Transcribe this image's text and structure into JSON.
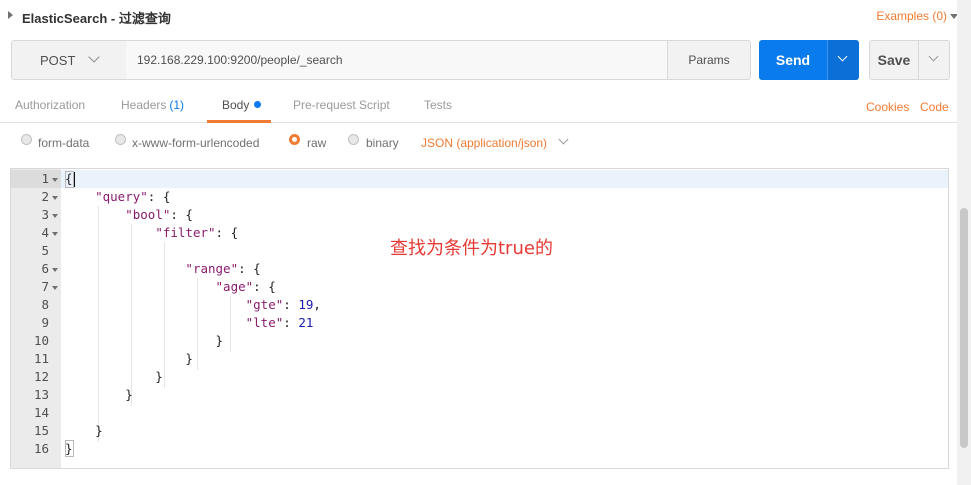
{
  "request": {
    "title": "ElasticSearch - 过滤查询",
    "examples_label": "Examples (0)"
  },
  "toolbar": {
    "method": "POST",
    "url": "192.168.229.100:9200/people/_search",
    "params_label": "Params",
    "send_label": "Send",
    "save_label": "Save"
  },
  "tabs": [
    {
      "label": "Authorization"
    },
    {
      "label": "Headers",
      "count": "(1)"
    },
    {
      "label": "Body",
      "active": true
    },
    {
      "label": "Pre-request Script"
    },
    {
      "label": "Tests"
    }
  ],
  "links": {
    "cookies": "Cookies",
    "code": "Code"
  },
  "body_options": {
    "items": [
      "form-data",
      "x-www-form-urlencoded",
      "raw",
      "binary"
    ],
    "selected": "raw",
    "content_type": "JSON (application/json)"
  },
  "editor": {
    "line_numbers": [
      "1",
      "2",
      "3",
      "4",
      "5",
      "6",
      "7",
      "8",
      "9",
      "10",
      "11",
      "12",
      "13",
      "14",
      "15",
      "16"
    ],
    "lines": [
      "{",
      "    \"query\": {",
      "        \"bool\": {",
      "            \"filter\": {",
      "",
      "                \"range\": {",
      "                    \"age\": {",
      "                        \"gte\": 19,",
      "                        \"lte\": 21",
      "                    }",
      "                }",
      "            }",
      "        }",
      "",
      "    }",
      "}"
    ]
  },
  "annotation": "查找为条件为true的",
  "colors": {
    "accent": "#f07b32",
    "send": "#097bed",
    "annotation": "#e53935"
  }
}
